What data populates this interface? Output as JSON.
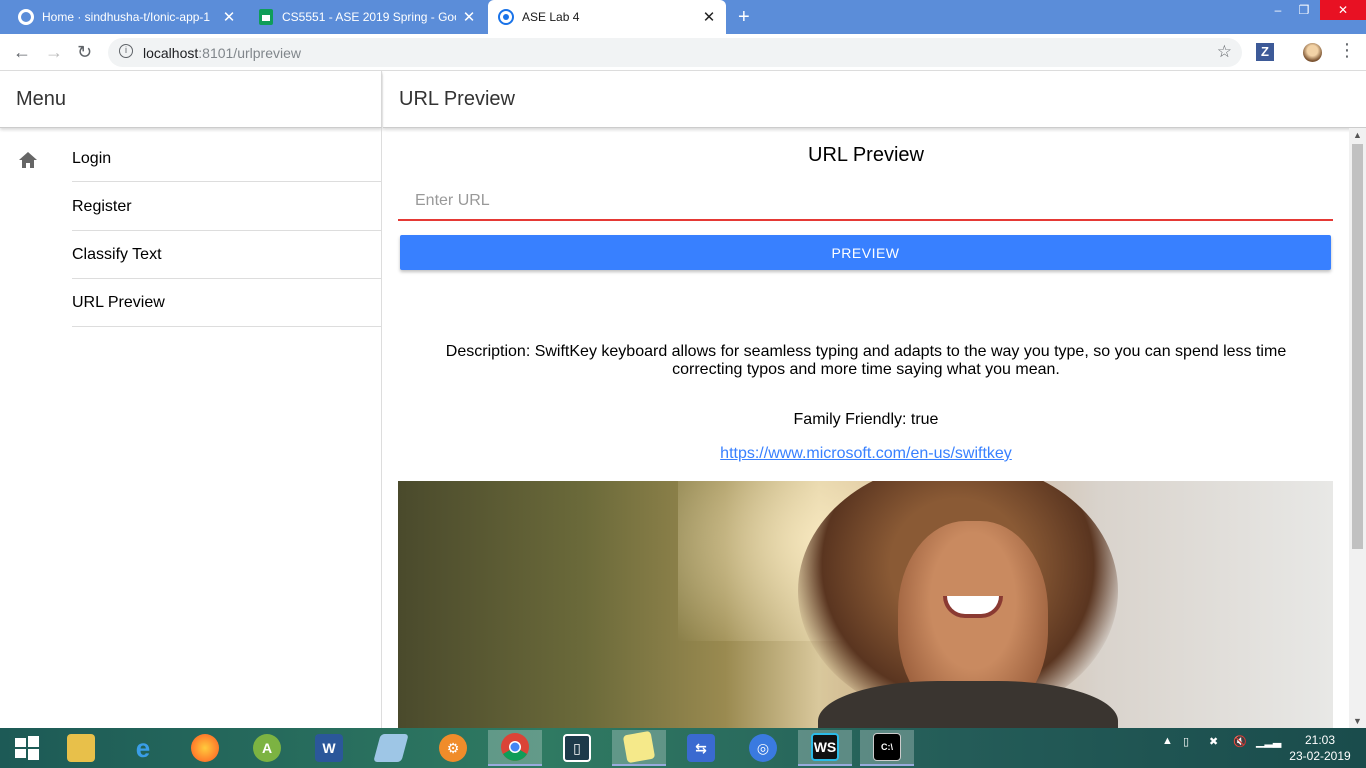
{
  "browser": {
    "tabs": [
      {
        "title": "Home · sindhusha-t/Ionic-app-1",
        "icon": "github-icon",
        "active": false
      },
      {
        "title": "CS5551 - ASE 2019 Spring - Goo",
        "icon": "sheets-icon",
        "active": false
      },
      {
        "title": "ASE Lab 4",
        "icon": "chrome-page-icon",
        "active": true
      }
    ],
    "new_tab": "+",
    "url_host": "localhost",
    "url_path": ":8101/urlpreview"
  },
  "app": {
    "menu_title": "Menu",
    "menu_items": [
      {
        "label": "Login"
      },
      {
        "label": "Register"
      },
      {
        "label": "Classify Text"
      },
      {
        "label": "URL Preview"
      }
    ],
    "page_title": "URL Preview",
    "content_title": "URL Preview",
    "url_input": {
      "placeholder": "Enter URL",
      "value": ""
    },
    "preview_button": "PREVIEW",
    "description": "Description: SwiftKey keyboard allows for seamless typing and adapts to the way you type, so you can spend less time correcting typos and more time saying what you mean.",
    "family_friendly": "Family Friendly: true",
    "link": "https://www.microsoft.com/en-us/swiftkey "
  },
  "taskbar": {
    "apps": [
      "start",
      "file-explorer",
      "internet-explorer",
      "firefox",
      "android-studio",
      "word",
      "notepad",
      "settings",
      "chrome",
      "lab-app",
      "sticky-notes",
      "network-tool",
      "edge-browser",
      "webstorm",
      "command-prompt"
    ],
    "active_app": "chrome",
    "time": "21:03",
    "date": "23-02-2019"
  },
  "colors": {
    "accent": "#3880ff",
    "input_underline": "#e53935",
    "tabstrip": "#5b8dd9"
  }
}
